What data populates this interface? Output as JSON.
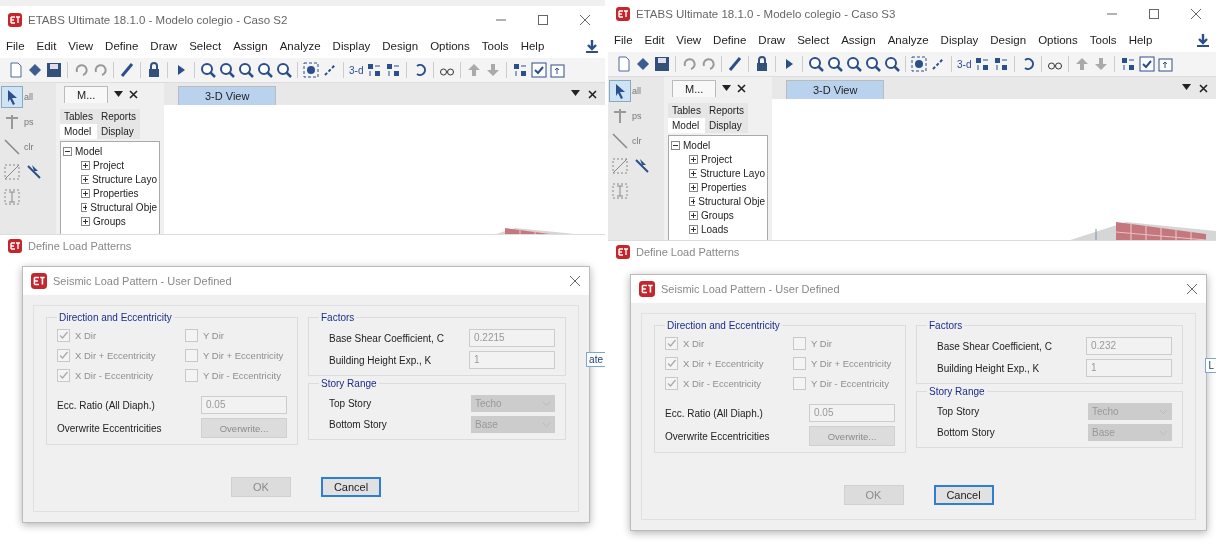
{
  "panes": [
    {
      "window": {
        "title": "ETABS Ultimate 18.1.0 - Modelo colegio - Caso S2"
      },
      "menu": [
        "File",
        "Edit",
        "View",
        "Define",
        "Draw",
        "Select",
        "Assign",
        "Analyze",
        "Display",
        "Design",
        "Options",
        "Tools",
        "Help"
      ],
      "toolbar": {
        "view_label": "3-d"
      },
      "side_tools": [
        "all",
        "ps",
        "clr"
      ],
      "explorer": {
        "tab": "M...",
        "tabs": [
          {
            "label": "Tables",
            "selected": false
          },
          {
            "label": "Reports",
            "selected": false
          },
          {
            "label": "Model",
            "selected": true
          },
          {
            "label": "Display",
            "selected": false
          }
        ],
        "tree": {
          "label": "Model",
          "expanded": true,
          "children": [
            {
              "label": "Project",
              "expanded": false
            },
            {
              "label": "Structure Layo",
              "expanded": false
            },
            {
              "label": "Properties",
              "expanded": false
            },
            {
              "label": "Structural Obje",
              "expanded": false
            },
            {
              "label": "Groups",
              "expanded": false
            }
          ]
        }
      },
      "view_tab": {
        "label": "3-D View",
        "selected": true
      },
      "parent_dialog": {
        "title": "Define Load Patterns",
        "edge_text": "ate"
      },
      "dialog": {
        "title": "Seismic Load Pattern - User Defined",
        "direction": {
          "title": "Direction and Eccentricity",
          "checks": [
            {
              "label": "X Dir",
              "checked": true
            },
            {
              "label": "Y Dir",
              "checked": false
            },
            {
              "label": "X Dir + Eccentricity",
              "checked": true
            },
            {
              "label": "Y Dir + Eccentricity",
              "checked": false
            },
            {
              "label": "X Dir - Eccentricity",
              "checked": true
            },
            {
              "label": "Y Dir - Eccentricity",
              "checked": false
            }
          ],
          "ecc_label": "Ecc. Ratio (All Diaph.)",
          "ecc_value": "0.05",
          "overwrite_label": "Overwrite Eccentricities",
          "overwrite_button": "Overwrite..."
        },
        "factors": {
          "title": "Factors",
          "fields": [
            {
              "label": "Base Shear Coefficient, C",
              "value": "0.2215"
            },
            {
              "label": "Building Height Exp., K",
              "value": "1"
            }
          ]
        },
        "story_range": {
          "title": "Story Range",
          "fields": [
            {
              "label": "Top Story",
              "value": "Techo"
            },
            {
              "label": "Bottom Story",
              "value": "Base"
            }
          ]
        },
        "buttons": [
          {
            "label": "OK",
            "disabled": true,
            "default": false
          },
          {
            "label": "Cancel",
            "disabled": false,
            "default": true
          }
        ]
      }
    },
    {
      "window": {
        "title": "ETABS Ultimate 18.1.0 - Modelo colegio - Caso S3"
      },
      "menu": [
        "File",
        "Edit",
        "View",
        "Define",
        "Draw",
        "Select",
        "Assign",
        "Analyze",
        "Display",
        "Design",
        "Options",
        "Tools",
        "Help"
      ],
      "toolbar": {
        "view_label": "3-d"
      },
      "side_tools": [
        "all",
        "ps",
        "clr"
      ],
      "explorer": {
        "tab": "M...",
        "tabs": [
          {
            "label": "Tables",
            "selected": false
          },
          {
            "label": "Reports",
            "selected": false
          },
          {
            "label": "Model",
            "selected": true
          },
          {
            "label": "Display",
            "selected": false
          }
        ],
        "tree": {
          "label": "Model",
          "expanded": true,
          "children": [
            {
              "label": "Project",
              "expanded": false
            },
            {
              "label": "Structure Layo",
              "expanded": false
            },
            {
              "label": "Properties",
              "expanded": false
            },
            {
              "label": "Structural Obje",
              "expanded": false
            },
            {
              "label": "Groups",
              "expanded": false
            },
            {
              "label": "Loads",
              "expanded": false
            }
          ]
        }
      },
      "view_tab": {
        "label": "3-D View",
        "selected": true
      },
      "parent_dialog": {
        "title": "Define Load Patterns",
        "edge_text": "L"
      },
      "dialog": {
        "title": "Seismic Load Pattern - User Defined",
        "direction": {
          "title": "Direction and Eccentricity",
          "checks": [
            {
              "label": "X Dir",
              "checked": true
            },
            {
              "label": "Y Dir",
              "checked": false
            },
            {
              "label": "X Dir + Eccentricity",
              "checked": true
            },
            {
              "label": "Y Dir + Eccentricity",
              "checked": false
            },
            {
              "label": "X Dir - Eccentricity",
              "checked": true
            },
            {
              "label": "Y Dir - Eccentricity",
              "checked": false
            }
          ],
          "ecc_label": "Ecc. Ratio (All Diaph.)",
          "ecc_value": "0.05",
          "overwrite_label": "Overwrite Eccentricities",
          "overwrite_button": "Overwrite..."
        },
        "factors": {
          "title": "Factors",
          "fields": [
            {
              "label": "Base Shear Coefficient, C",
              "value": "0.232"
            },
            {
              "label": "Building Height Exp., K",
              "value": "1"
            }
          ]
        },
        "story_range": {
          "title": "Story Range",
          "fields": [
            {
              "label": "Top Story",
              "value": "Techo"
            },
            {
              "label": "Bottom Story",
              "value": "Base"
            }
          ]
        },
        "buttons": [
          {
            "label": "OK",
            "disabled": true,
            "default": false
          },
          {
            "label": "Cancel",
            "disabled": false,
            "default": true
          }
        ]
      }
    }
  ]
}
